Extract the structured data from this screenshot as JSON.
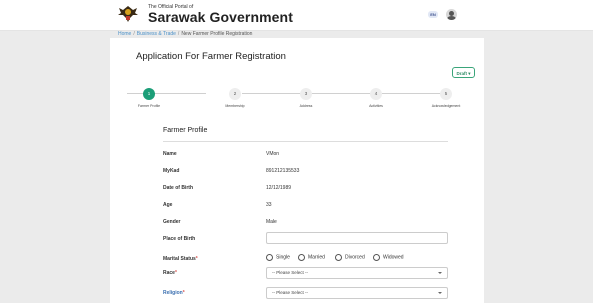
{
  "header": {
    "portal_small": "The Official Portal of",
    "portal_big": "Sarawak Government",
    "lang_label": "EN"
  },
  "breadcrumb": {
    "home": "Home",
    "section": "Business & Trade",
    "current": "New Farmer Profile Registration"
  },
  "page": {
    "title": "Application For Farmer Registration",
    "draft_label": "Draft ▾"
  },
  "stepper": {
    "steps": [
      {
        "num": "1",
        "label": "Farmer Profile",
        "active": true
      },
      {
        "num": "2",
        "label": "Membership",
        "active": false
      },
      {
        "num": "3",
        "label": "Address",
        "active": false
      },
      {
        "num": "4",
        "label": "Activities",
        "active": false
      },
      {
        "num": "5",
        "label": "Acknowledgement",
        "active": false
      }
    ]
  },
  "section": {
    "title": "Farmer Profile"
  },
  "fields": {
    "name_label": "Name",
    "name_value": "VMon",
    "mykad_label": "MyKad",
    "mykad_value": "891212135533",
    "dob_label": "Date of Birth",
    "dob_value": "12/12/1989",
    "age_label": "Age",
    "age_value": "33",
    "gender_label": "Gender",
    "gender_value": "Male",
    "pob_label": "Place of Birth",
    "pob_value": "",
    "marital_label": "Marital Status",
    "marital_options": [
      "Single",
      "Married",
      "Divorced",
      "Widowed"
    ],
    "race_label": "Race",
    "race_placeholder": "-- Please Select --",
    "religion_label": "Religion",
    "religion_placeholder": "-- Please Select --",
    "required_mark": "*"
  },
  "colors": {
    "accent": "#1c9e78",
    "link": "#4a90c8",
    "required": "#d9534f"
  }
}
